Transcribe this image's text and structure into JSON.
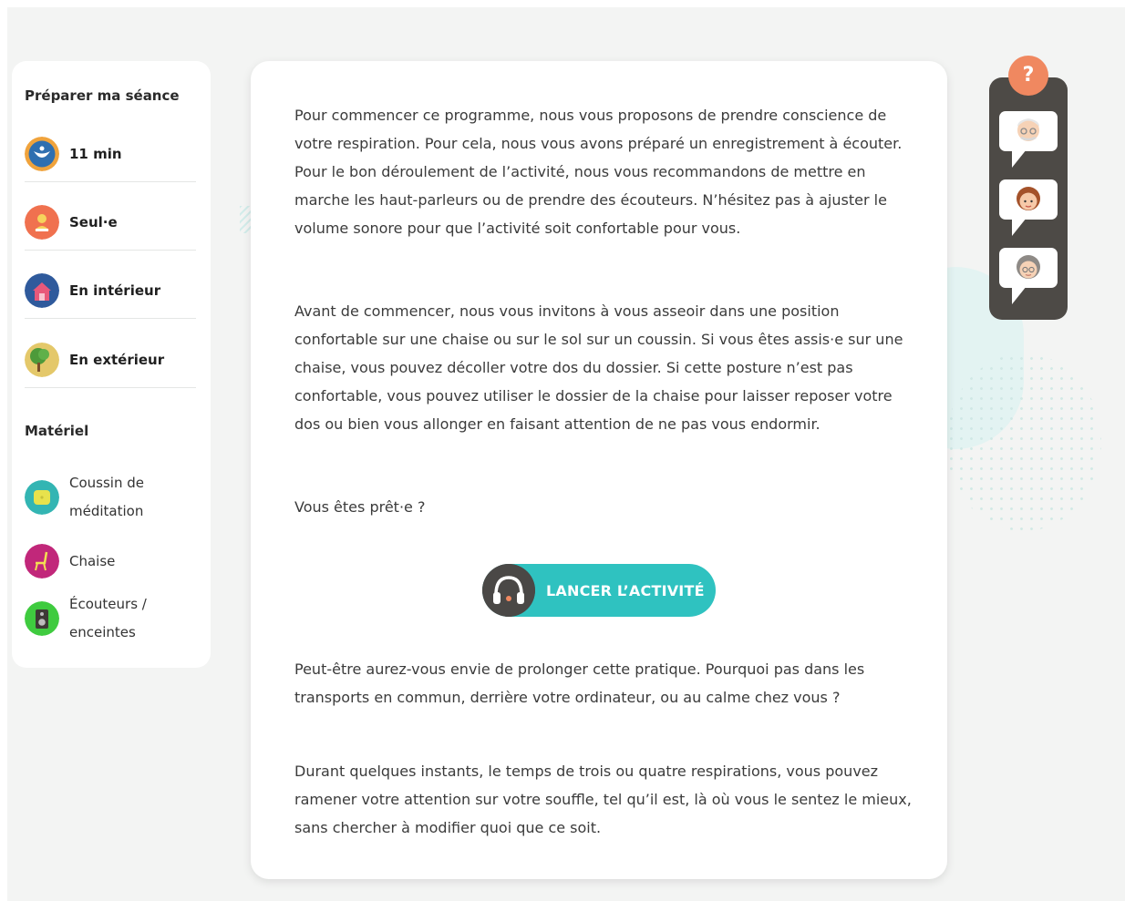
{
  "sidebar": {
    "prepare_heading": "Préparer ma séance",
    "prepare_items": [
      {
        "label": "11 min",
        "icon": "clock-icon"
      },
      {
        "label": "Seul·e",
        "icon": "person-icon"
      },
      {
        "label": "En intérieur",
        "icon": "house-icon"
      },
      {
        "label": "En extérieur",
        "icon": "tree-icon"
      }
    ],
    "material_heading": "Matériel",
    "material_items": [
      {
        "label": "Coussin de méditation",
        "icon": "cushion-icon"
      },
      {
        "label": "Chaise",
        "icon": "chair-icon"
      },
      {
        "label": "Écouteurs / enceintes",
        "icon": "speaker-icon"
      }
    ]
  },
  "content": {
    "paragraphs": [
      "Pour commencer ce programme, nous vous proposons de prendre conscience de votre respiration. Pour cela, nous vous avons préparé un enregistrement à écouter. Pour le bon déroulement de l’activité, nous vous recommandons de mettre en marche les haut-parleurs ou de prendre des écouteurs. N’hésitez pas à ajuster le volume sonore pour que l’activité soit confortable pour vous.",
      "Avant de commencer, nous vous invitons à vous asseoir dans une position confortable sur une chaise ou sur le sol sur un coussin. Si vous êtes assis·e sur une chaise, vous pouvez décoller votre dos du dossier. Si cette posture n’est pas confortable, vous pouvez utiliser le dossier de la chaise pour laisser reposer votre dos ou bien vous allonger en faisant attention de ne pas vous endormir.",
      "Vous êtes prêt·e ?",
      "Peut-être aurez-vous envie de prolonger cette pratique. Pourquoi pas dans les transports en commun, derrière votre ordinateur, ou au calme chez vous ?",
      "Durant quelques instants, le temps de trois ou quatre respirations, vous pouvez ramener votre attention sur votre souffle, tel qu’il est, là où vous le sentez le mieux, sans chercher à modifier quoi que ce soit."
    ],
    "launch_button": "LANCER L’ACTIVITÉ",
    "launch_icon": "headphones-icon"
  },
  "helper": {
    "help_label": "?",
    "avatars": [
      "elderly-man-avatar-icon",
      "young-woman-avatar-icon",
      "elderly-woman-avatar-icon"
    ]
  },
  "colors": {
    "accent": "#2fc2c0",
    "help": "#f08860",
    "panel": "#4d4a46"
  }
}
